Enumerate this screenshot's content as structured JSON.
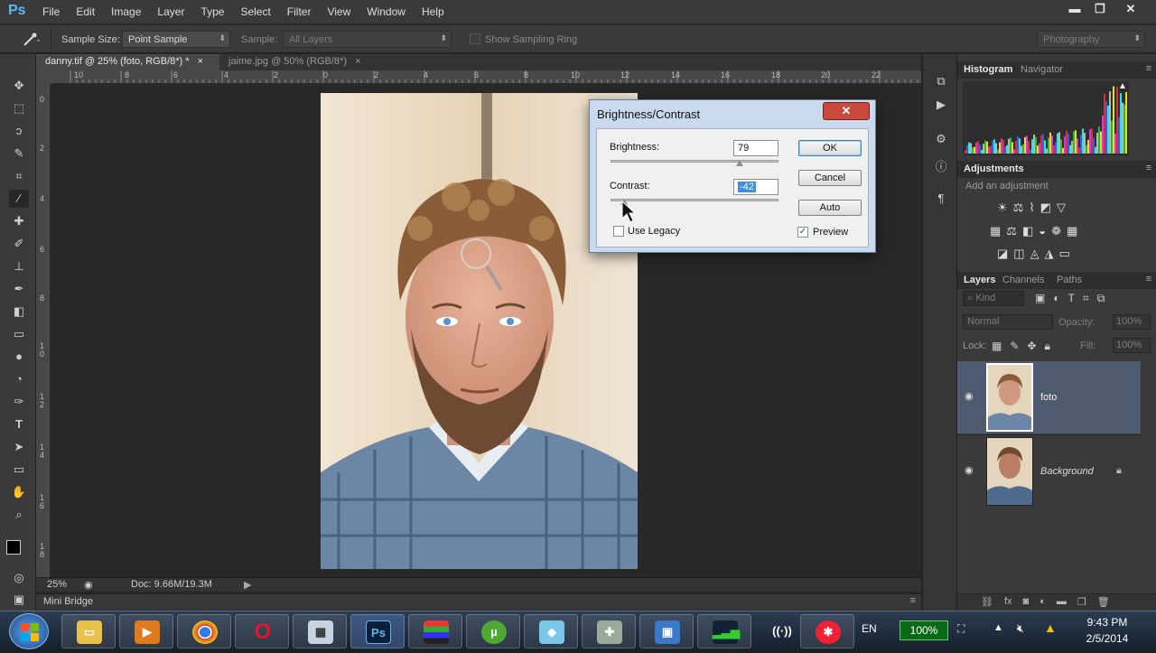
{
  "app": {
    "logo": "Ps",
    "menu": [
      "File",
      "Edit",
      "Image",
      "Layer",
      "Type",
      "Select",
      "Filter",
      "View",
      "Window",
      "Help"
    ],
    "window_controls": {
      "minimize": "▬",
      "restore": "❐",
      "close": "✕"
    }
  },
  "options_bar": {
    "sample_size_label": "Sample Size:",
    "sample_size_value": "Point Sample",
    "sample_label": "Sample:",
    "sample_value": "All Layers",
    "show_sampling_ring": "Show Sampling Ring",
    "workspace": "Photography"
  },
  "tabs": [
    {
      "label": "danny.tif @ 25% (foto, RGB/8*) *",
      "close": "×"
    },
    {
      "label": "jaime.jpg @ 50% (RGB/8*)",
      "close": "×"
    }
  ],
  "ruler_top_labels": [
    "10",
    "8",
    "6",
    "4",
    "2",
    "0",
    "2",
    "4",
    "6",
    "8",
    "10",
    "12",
    "14",
    "16",
    "18",
    "20",
    "22"
  ],
  "ruler_left_labels": [
    "0",
    "2",
    "4",
    "6",
    "8",
    "1\n0",
    "1\n2",
    "1\n4",
    "1\n6",
    "1\n8"
  ],
  "status": {
    "zoom": "25%",
    "doc": "Doc: 9.66M/19.3M"
  },
  "mini_bridge": "Mini Bridge",
  "panels": {
    "histogram_tab": "Histogram",
    "navigator_tab": "Navigator",
    "adjustments_title": "Adjustments",
    "add_adjustment": "Add an adjustment",
    "layers_tab": "Layers",
    "channels_tab": "Channels",
    "paths_tab": "Paths",
    "kind": "Kind",
    "blend_mode": "Normal",
    "opacity_label": "Opacity:",
    "opacity_value": "100%",
    "lock_label": "Lock:",
    "fill_label": "Fill:",
    "fill_value": "100%",
    "layers": [
      {
        "name": "foto",
        "selected": true
      },
      {
        "name": "Background",
        "selected": false,
        "locked": true
      }
    ]
  },
  "dialog": {
    "title": "Brightness/Contrast",
    "close": "✕",
    "brightness_label": "Brightness:",
    "brightness_value": "79",
    "contrast_label": "Contrast:",
    "contrast_value": "-42",
    "use_legacy": "Use Legacy",
    "preview": "Preview",
    "preview_checked": true,
    "ok": "OK",
    "cancel": "Cancel",
    "auto": "Auto"
  },
  "taskbar": {
    "language": "EN",
    "battery": "100%",
    "time": "9:43 PM",
    "date": "2/5/2014",
    "ps_icon": "Ps"
  }
}
